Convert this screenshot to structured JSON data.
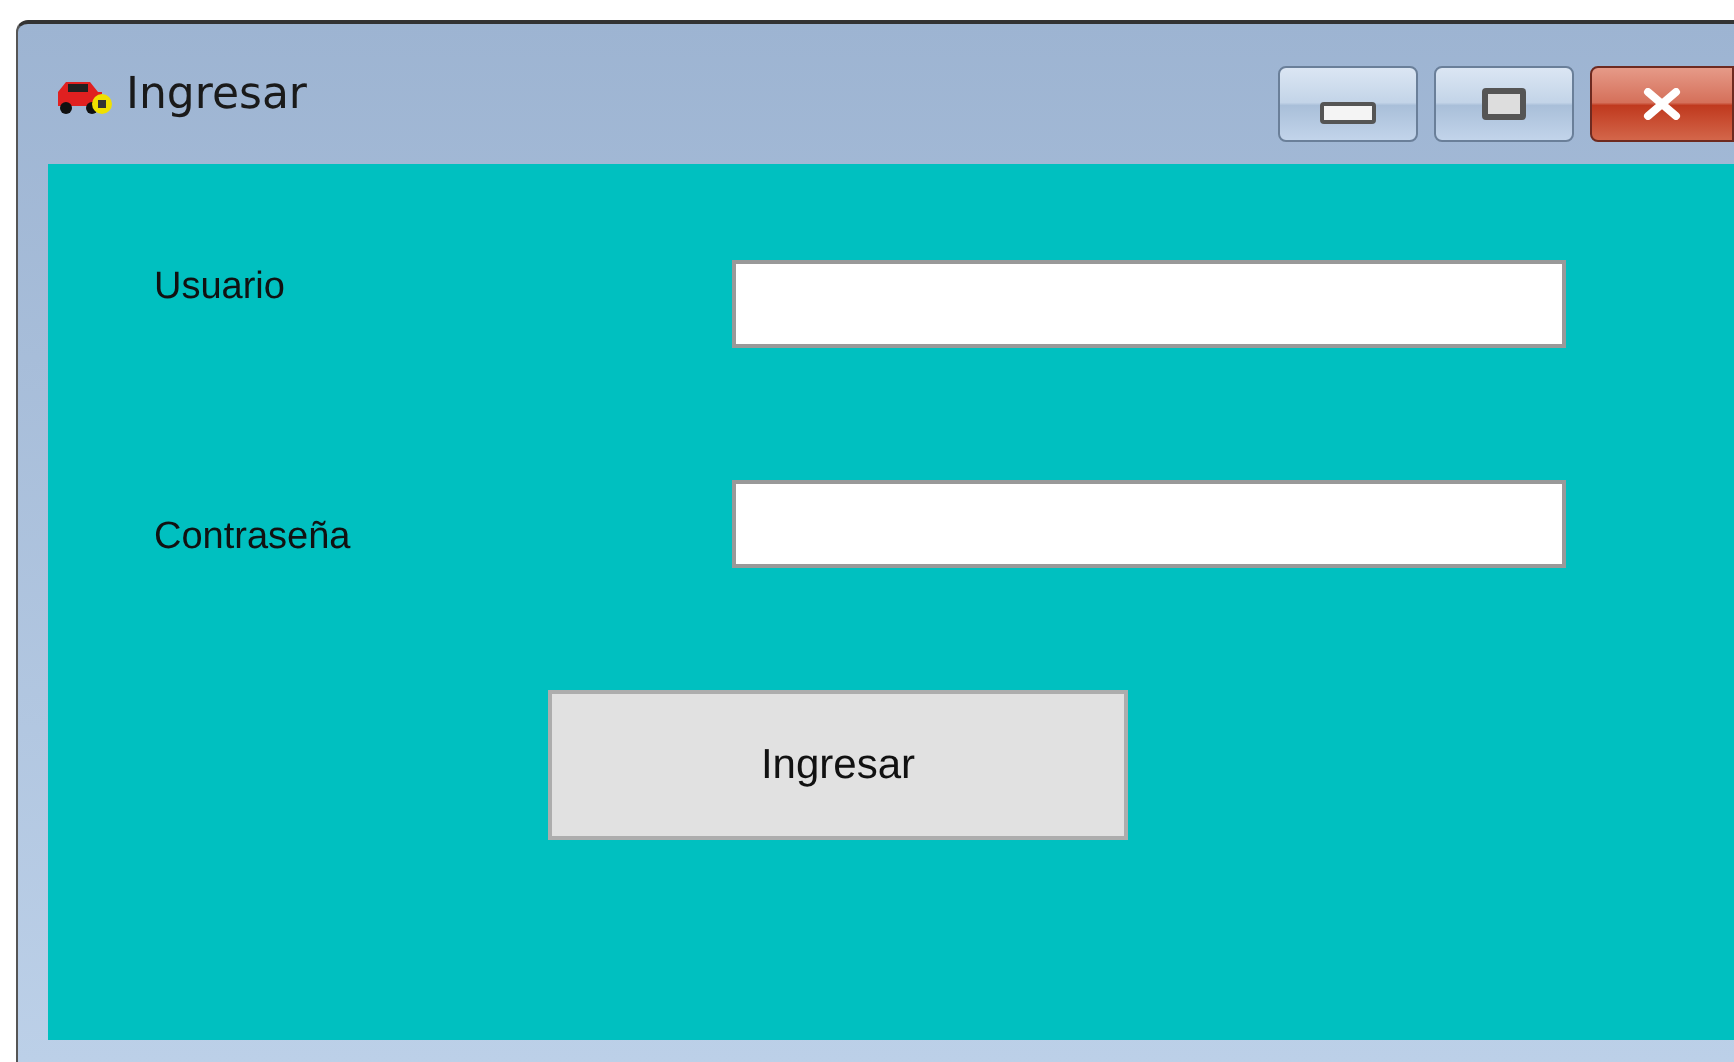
{
  "window": {
    "title": "Ingresar"
  },
  "fields": [
    {
      "label": "Usuario"
    },
    {
      "label": "Contraseña"
    }
  ],
  "button": "Ingresar"
}
